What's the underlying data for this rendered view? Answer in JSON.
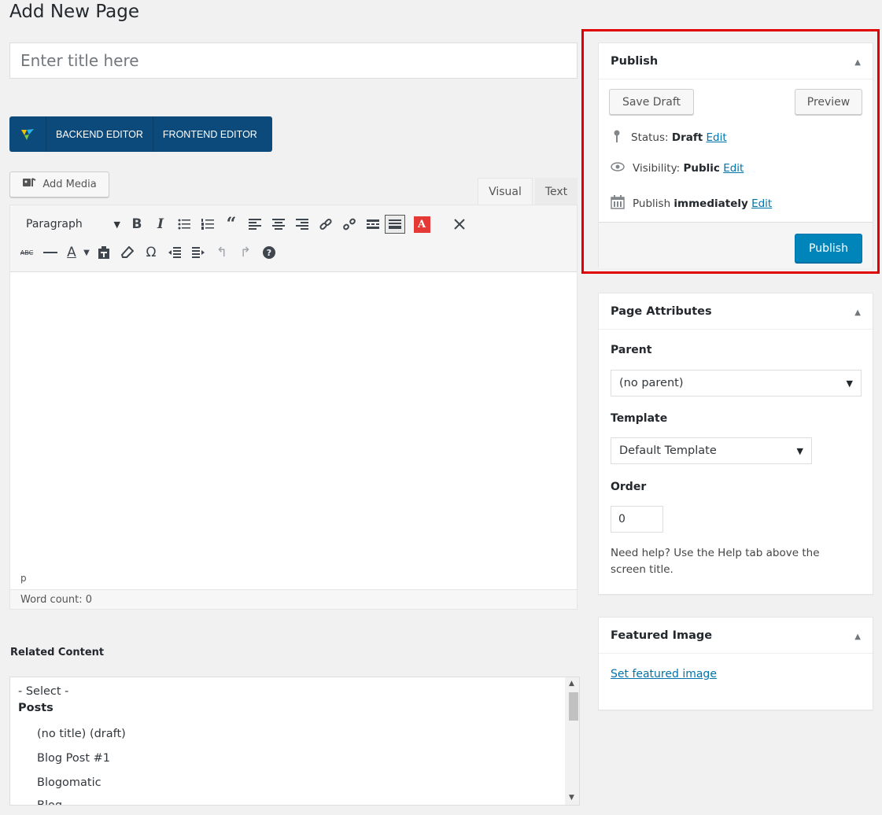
{
  "page": {
    "heading": "Add New Page"
  },
  "title_input": {
    "placeholder": "Enter title here",
    "value": ""
  },
  "vc_bar": {
    "backend": "BACKEND EDITOR",
    "frontend": "FRONTEND EDITOR"
  },
  "editor": {
    "add_media": "Add Media",
    "tabs": {
      "visual": "Visual",
      "text": "Text",
      "active": "Visual"
    },
    "format_select": "Paragraph",
    "path": "p",
    "word_count": "Word count: 0",
    "content": ""
  },
  "related": {
    "heading": "Related Content",
    "options": {
      "select": "- Select -",
      "group": "Posts",
      "items": [
        "(no title) (draft)",
        "Blog Post #1",
        "Blogomatic",
        "Blog..."
      ]
    }
  },
  "publish": {
    "title": "Publish",
    "save_draft": "Save Draft",
    "preview": "Preview",
    "status_label": "Status:",
    "status_value": "Draft",
    "visibility_label": "Visibility:",
    "visibility_value": "Public",
    "publish_label": "Publish",
    "publish_value": "immediately",
    "edit": "Edit",
    "publish_button": "Publish"
  },
  "attributes": {
    "title": "Page Attributes",
    "parent_label": "Parent",
    "parent_value": "(no parent)",
    "template_label": "Template",
    "template_value": "Default Template",
    "order_label": "Order",
    "order_value": "0",
    "help": "Need help? Use the Help tab above the screen title."
  },
  "featured": {
    "title": "Featured Image",
    "link": "Set featured image"
  },
  "colors": {
    "primary": "#0085ba",
    "link": "#0073aa",
    "vc_bar": "#0c4a7b",
    "highlight": "#e00000"
  }
}
